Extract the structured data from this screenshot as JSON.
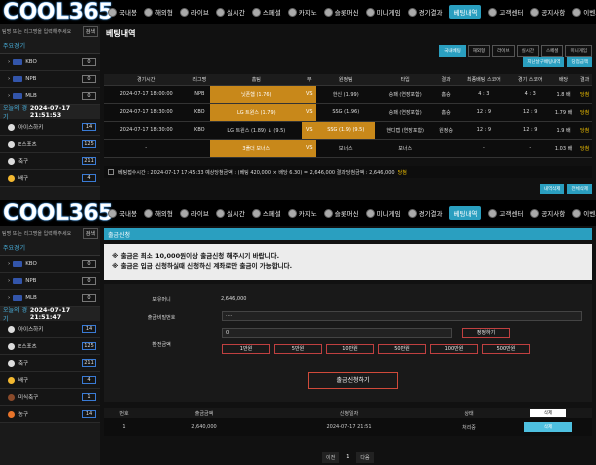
{
  "logo": "COOL365",
  "nav": [
    "국내봉",
    "해외형",
    "라이브",
    "실시간",
    "스페셜",
    "카지노",
    "슬롯머신",
    "미니게임",
    "경기결과",
    "베팅내역",
    "고객센터",
    "공지사항",
    "이벤트"
  ],
  "sidebar": {
    "search_placeholder": "팀명 또는 리그명을 입력해주세요",
    "search_btn": "검색",
    "main_title": "주요경기",
    "major": [
      {
        "name": "KBO",
        "count": "0"
      },
      {
        "name": "NPB",
        "count": "0"
      },
      {
        "name": "MLB",
        "count": "0"
      }
    ],
    "today_label": "오늘의 경기",
    "datetime1": "2024-07-17 21:51:53",
    "datetime2": "2024-07-17 21:51:47",
    "sports1": [
      {
        "name": "아이스하키",
        "count": "14"
      },
      {
        "name": "E스포츠",
        "count": "125"
      },
      {
        "name": "축구",
        "count": "211"
      },
      {
        "name": "배구",
        "count": "4"
      }
    ],
    "sports2": [
      {
        "name": "아이스하키",
        "count": "14"
      },
      {
        "name": "E스포츠",
        "count": "125"
      },
      {
        "name": "축구",
        "count": "211"
      },
      {
        "name": "배구",
        "count": "4"
      },
      {
        "name": "미식축구",
        "count": "1"
      },
      {
        "name": "농구",
        "count": "14"
      }
    ]
  },
  "bet": {
    "title": "베팅내역",
    "tabs": [
      "국내베팅",
      "해외형",
      "라이브",
      "실시간",
      "스페셜",
      "미니게임"
    ],
    "btn_a": "지난날구배팅내역",
    "btn_b": "당첨금액",
    "headers": [
      "경기시간",
      "리그명",
      "홈팀",
      "무",
      "원정팀",
      "타입",
      "결과",
      "최종배팅 스코어",
      "경기 스코어",
      "배당",
      "결과"
    ],
    "rows": [
      [
        "2024-07-17 18:00:00",
        "NPB",
        "닛폰햄 (1.76)",
        "VS",
        "한신 (1.99)",
        "승패 (연장포함)",
        "홈승",
        "4 : 3",
        "4 : 3",
        "1.8 배",
        "당첨"
      ],
      [
        "2024-07-17 18:30:00",
        "KBO",
        "LG 트윈스 (1.79)",
        "VS",
        "SSG (1.96)",
        "승패 (연장포함)",
        "홈승",
        "12 : 9",
        "12 : 9",
        "1.79 배",
        "당첨"
      ],
      [
        "2024-07-17 18:30:00",
        "KBO",
        "LG 트윈스 (1.89) ↓ (9.5)",
        "VS",
        "SSG (1.9) (9.5)",
        "핸디캡 (연장포함)",
        "원정승",
        "12 : 9",
        "12 : 9",
        "1.9 배",
        "당첨"
      ],
      [
        "-",
        "",
        "3폴더 보너스",
        "VS",
        "보너스",
        "보너스",
        "",
        "-",
        "-",
        "1.03 배",
        "당첨"
      ]
    ],
    "footer": "베팅접수시간 : 2024-07-17 17:45:33   예상당첨금액 : (베팅 420,000 × 배당 6.30) = 2,646,000   결과당첨금액 : 2,646,000",
    "footer_status": "당첨",
    "btn_c": "내역삭제",
    "btn_d": "전체삭제"
  },
  "withdraw": {
    "title": "출금신청",
    "notice1": "※ 출금은 최소 10,000원이상 출금신청 해주시기 바랍니다.",
    "notice2": "※ 출금은 입금 신청하실때 신청하신 계좌로만 출금이 가능합니다.",
    "balance_label": "보유머니",
    "balance": "2,646,000",
    "pw_label": "출금비밀번호",
    "pw": "····",
    "amount_label": "환전금액",
    "amount": "0",
    "reset": "정정하기",
    "amounts": [
      "1만원",
      "5만원",
      "10만원",
      "50만원",
      "100만원",
      "500만원"
    ],
    "submit": "출금신청하기",
    "headers": [
      "번호",
      "출금금액",
      "신청일자",
      "상태",
      "삭제"
    ],
    "row": [
      "1",
      "2,640,000",
      "2024-07-17 21:51",
      "처리중",
      "삭제"
    ],
    "pager": [
      "이전",
      "1",
      "다음"
    ]
  }
}
